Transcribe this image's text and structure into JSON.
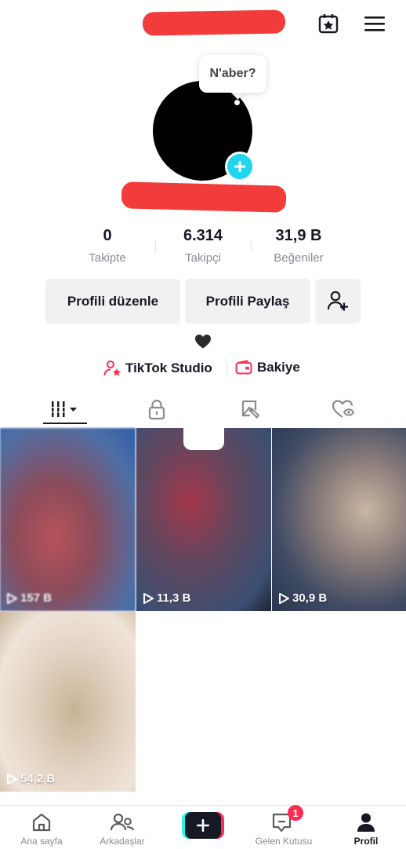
{
  "header": {
    "calendar_icon": "calendar-star-icon",
    "menu_icon": "hamburger-menu-icon"
  },
  "profile": {
    "bubble_text": "N'aber?",
    "add_icon": "plus-icon"
  },
  "stats": [
    {
      "value": "0",
      "label": "Takipte"
    },
    {
      "value": "6.314",
      "label": "Takipçi"
    },
    {
      "value": "31,9 B",
      "label": "Beğeniler"
    }
  ],
  "actions": {
    "edit_profile": "Profili düzenle",
    "share_profile": "Profili Paylaş",
    "add_friend_icon": "add-friend-icon"
  },
  "links": {
    "studio": "TikTok Studio",
    "balance": "Bakiye"
  },
  "tabs": [
    "videos-grid-icon",
    "lock-icon",
    "tagged-icon",
    "liked-icon"
  ],
  "videos": [
    {
      "views": "157 B"
    },
    {
      "views": "11,3 B"
    },
    {
      "views": "30,9 B"
    },
    {
      "views": "54,2 B"
    }
  ],
  "nav": {
    "home": "Ana sayfa",
    "friends": "Arkadaşlar",
    "inbox": "Gelen Kutusu",
    "inbox_badge": "1",
    "profile": "Profil"
  },
  "colors": {
    "accent": "#fe2c55",
    "cyan": "#20d5ec",
    "redact": "#f23c3c"
  }
}
